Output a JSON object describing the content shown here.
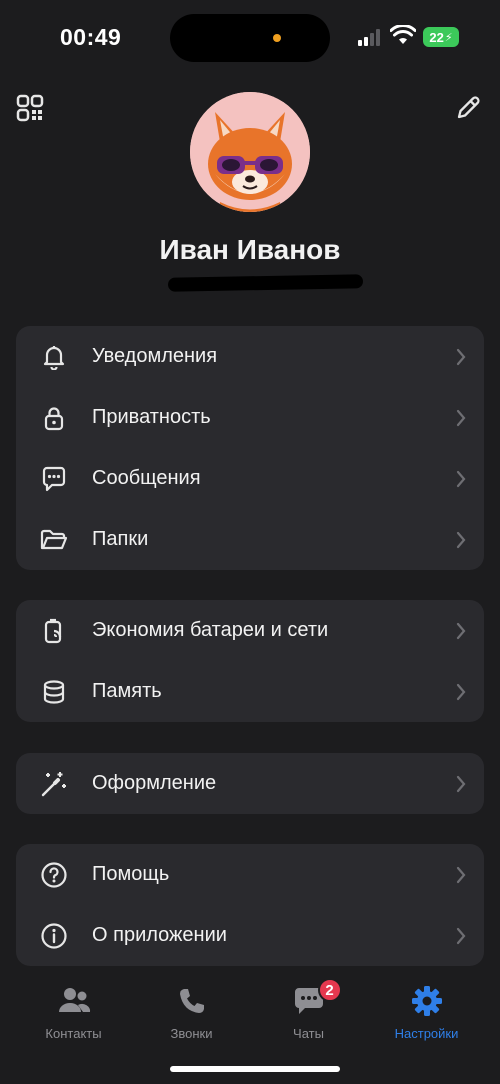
{
  "status_bar": {
    "time": "00:49",
    "battery": "22"
  },
  "profile": {
    "name": "Иван Иванов"
  },
  "groups": [
    {
      "items": [
        {
          "icon": "bell-icon",
          "label": "Уведомления"
        },
        {
          "icon": "lock-icon",
          "label": "Приватность"
        },
        {
          "icon": "message-icon",
          "label": "Сообщения"
        },
        {
          "icon": "folder-icon",
          "label": "Папки"
        }
      ]
    },
    {
      "items": [
        {
          "icon": "battery-saver-icon",
          "label": "Экономия батареи и сети"
        },
        {
          "icon": "storage-icon",
          "label": "Память"
        }
      ]
    },
    {
      "items": [
        {
          "icon": "magic-wand-icon",
          "label": "Оформление"
        }
      ]
    },
    {
      "items": [
        {
          "icon": "help-icon",
          "label": "Помощь"
        },
        {
          "icon": "info-icon",
          "label": "О приложении"
        }
      ]
    }
  ],
  "tabs": [
    {
      "icon": "contacts-icon",
      "label": "Контакты"
    },
    {
      "icon": "phone-icon",
      "label": "Звонки"
    },
    {
      "icon": "chat-icon",
      "label": "Чаты",
      "badge": "2"
    },
    {
      "icon": "gear-icon",
      "label": "Настройки",
      "active": true
    }
  ],
  "colors": {
    "accent": "#2f7fe8",
    "badge": "#e5384f",
    "card": "#2a2a2e",
    "background": "#1c1c1e"
  }
}
